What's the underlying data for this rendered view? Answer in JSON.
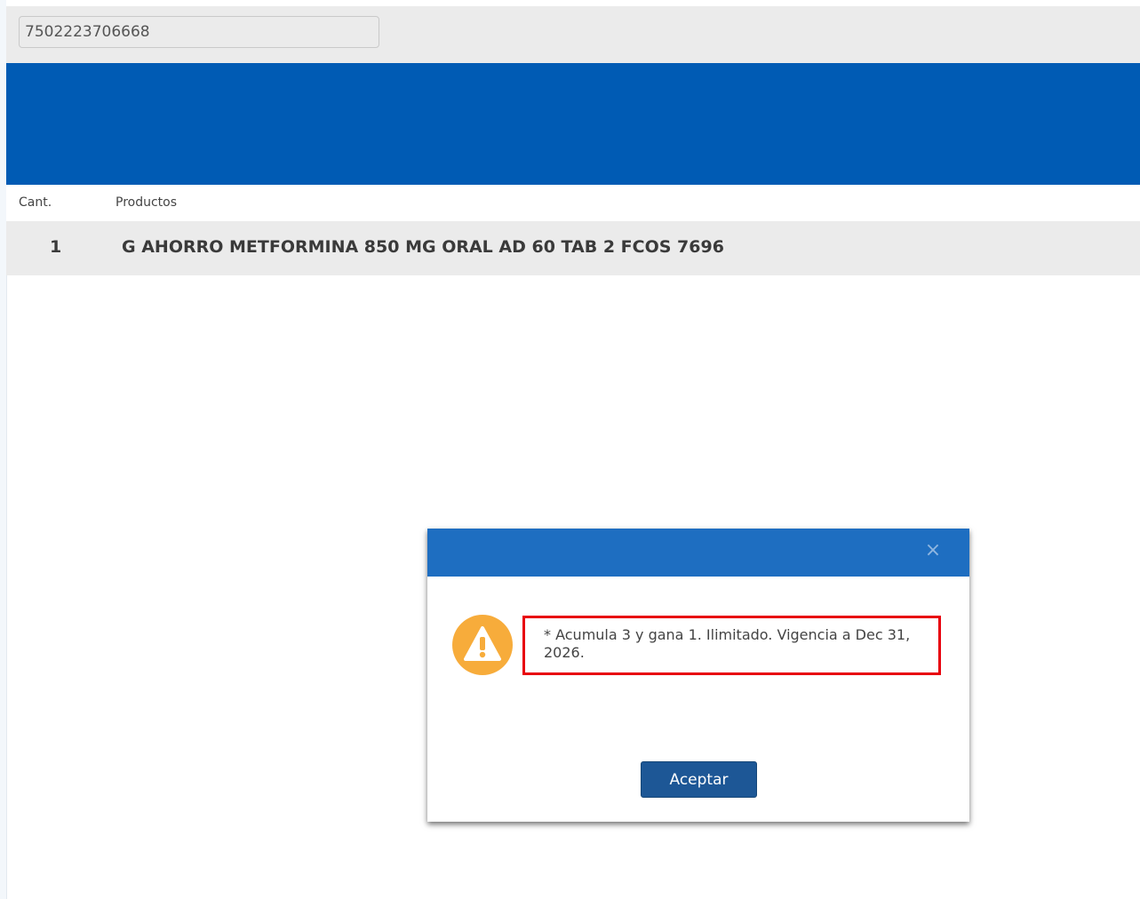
{
  "search": {
    "barcode_value": "7502223706668"
  },
  "table": {
    "headers": {
      "quantity": "Cant.",
      "products": "Productos"
    },
    "rows": [
      {
        "quantity": "1",
        "product": "G AHORRO METFORMINA 850 MG ORAL AD 60 TAB 2 FCOS 7696"
      }
    ]
  },
  "dialog": {
    "close_symbol": "×",
    "icon": "warning-icon",
    "message": "* Acumula 3 y gana 1. Ilimitado. Vigencia a Dec 31, 2026.",
    "accept_label": "Aceptar"
  },
  "colors": {
    "banner": "#005bb4",
    "dialog_header": "#1e6ec1",
    "accept_button": "#1d5796",
    "warning": "#f7ac3b",
    "highlight_border": "#e8000d"
  }
}
